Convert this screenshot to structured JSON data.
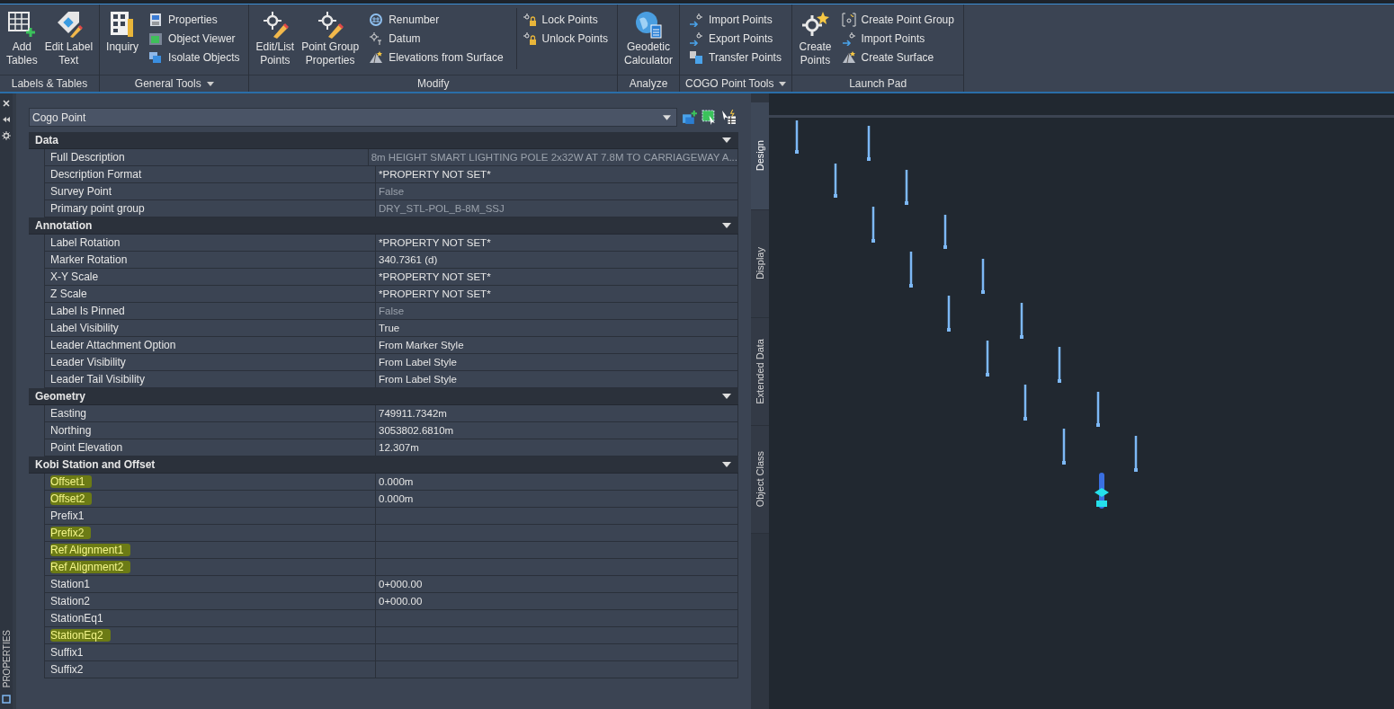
{
  "ribbon": {
    "panels": [
      {
        "title": "Labels & Tables",
        "has_menu": false,
        "columns": [
          {
            "kind": "large",
            "items": [
              {
                "label": "Add\nTables"
              },
              {
                "label": "Edit Label\nText"
              }
            ]
          }
        ]
      },
      {
        "title": "General Tools",
        "has_menu": true,
        "columns": [
          {
            "kind": "large",
            "items": [
              {
                "label": "Inquiry"
              }
            ]
          },
          {
            "kind": "small",
            "items": [
              {
                "label": "Properties"
              },
              {
                "label": "Object Viewer"
              },
              {
                "label": "Isolate Objects"
              }
            ]
          }
        ]
      },
      {
        "title": "Modify",
        "has_menu": false,
        "columns": [
          {
            "kind": "large",
            "items": [
              {
                "label": "Edit/List\nPoints"
              },
              {
                "label": "Point Group\nProperties"
              }
            ]
          },
          {
            "kind": "small",
            "items": [
              {
                "label": "Renumber"
              },
              {
                "label": "Datum"
              },
              {
                "label": "Elevations from Surface"
              }
            ]
          },
          {
            "kind": "small",
            "items": [
              {
                "label": "Lock Points"
              },
              {
                "label": "Unlock Points"
              }
            ]
          }
        ]
      },
      {
        "title": "Analyze",
        "has_menu": false,
        "columns": [
          {
            "kind": "large",
            "items": [
              {
                "label": "Geodetic\nCalculator"
              }
            ]
          }
        ]
      },
      {
        "title": "COGO Point Tools",
        "has_menu": true,
        "columns": [
          {
            "kind": "small",
            "items": [
              {
                "label": "Import Points"
              },
              {
                "label": "Export Points"
              },
              {
                "label": "Transfer Points"
              }
            ]
          }
        ]
      },
      {
        "title": "Launch Pad",
        "has_menu": false,
        "columns": [
          {
            "kind": "large",
            "items": [
              {
                "label": "Create\nPoints"
              }
            ]
          },
          {
            "kind": "small",
            "items": [
              {
                "label": "Create Point Group"
              },
              {
                "label": "Import Points"
              },
              {
                "label": "Create Surface"
              }
            ]
          }
        ]
      }
    ]
  },
  "palette": {
    "title": "PROPERTIES",
    "object_type": "Cogo Point",
    "sections": [
      {
        "title": "Data",
        "expanded": true,
        "rows": [
          {
            "label": "Full Description",
            "value": "8m HEIGHT SMART LIGHTING POLE 2x32W AT 7.8M TO CARRIAGEWAY A...",
            "readonly": true,
            "highlighted": false
          },
          {
            "label": "Description Format",
            "value": "*PROPERTY NOT SET*",
            "readonly": false,
            "highlighted": false
          },
          {
            "label": "Survey Point",
            "value": "False",
            "readonly": true,
            "highlighted": false
          },
          {
            "label": "Primary point group",
            "value": "DRY_STL-POL_B-8M_SSJ",
            "readonly": true,
            "highlighted": false
          }
        ]
      },
      {
        "title": "Annotation",
        "expanded": true,
        "rows": [
          {
            "label": "Label Rotation",
            "value": "*PROPERTY NOT SET*",
            "readonly": false,
            "highlighted": false
          },
          {
            "label": "Marker Rotation",
            "value": "340.7361 (d)",
            "readonly": false,
            "highlighted": false
          },
          {
            "label": "X-Y Scale",
            "value": "*PROPERTY NOT SET*",
            "readonly": false,
            "highlighted": false
          },
          {
            "label": "Z Scale",
            "value": "*PROPERTY NOT SET*",
            "readonly": false,
            "highlighted": false
          },
          {
            "label": "Label Is Pinned",
            "value": "False",
            "readonly": true,
            "highlighted": false
          },
          {
            "label": "Label Visibility",
            "value": "True",
            "readonly": false,
            "highlighted": false
          },
          {
            "label": "Leader Attachment Option",
            "value": "From Marker Style",
            "readonly": false,
            "highlighted": false
          },
          {
            "label": "Leader Visibility",
            "value": "From Label Style",
            "readonly": false,
            "highlighted": false
          },
          {
            "label": "Leader Tail Visibility",
            "value": "From Label Style",
            "readonly": false,
            "highlighted": false
          }
        ]
      },
      {
        "title": "Geometry",
        "expanded": true,
        "rows": [
          {
            "label": "Easting",
            "value": "749911.7342m",
            "readonly": false,
            "highlighted": false
          },
          {
            "label": "Northing",
            "value": "3053802.6810m",
            "readonly": false,
            "highlighted": false
          },
          {
            "label": "Point Elevation",
            "value": "12.307m",
            "readonly": false,
            "highlighted": false
          }
        ]
      },
      {
        "title": "Kobi Station and Offset",
        "expanded": true,
        "rows": [
          {
            "label": "Offset1",
            "value": "0.000m",
            "readonly": false,
            "highlighted": true
          },
          {
            "label": "Offset2",
            "value": "0.000m",
            "readonly": false,
            "highlighted": true
          },
          {
            "label": "Prefix1",
            "value": "",
            "readonly": false,
            "highlighted": false
          },
          {
            "label": "Prefix2",
            "value": "",
            "readonly": false,
            "highlighted": true
          },
          {
            "label": "Ref Alignment1",
            "value": "",
            "readonly": false,
            "highlighted": true
          },
          {
            "label": "Ref Alignment2",
            "value": "",
            "readonly": false,
            "highlighted": true
          },
          {
            "label": "Station1",
            "value": "0+000.00",
            "readonly": false,
            "highlighted": false
          },
          {
            "label": "Station2",
            "value": "0+000.00",
            "readonly": false,
            "highlighted": false
          },
          {
            "label": "StationEq1",
            "value": "",
            "readonly": false,
            "highlighted": false
          },
          {
            "label": "StationEq2",
            "value": "",
            "readonly": false,
            "highlighted": true
          },
          {
            "label": "Suffix1",
            "value": "",
            "readonly": false,
            "highlighted": false
          },
          {
            "label": "Suffix2",
            "value": "",
            "readonly": false,
            "highlighted": false
          }
        ]
      }
    ],
    "tabs": [
      {
        "label": "Design",
        "selected": true
      },
      {
        "label": "Display",
        "selected": false
      },
      {
        "label": "Extended Data",
        "selected": false
      },
      {
        "label": "Object Class",
        "selected": false
      }
    ]
  }
}
